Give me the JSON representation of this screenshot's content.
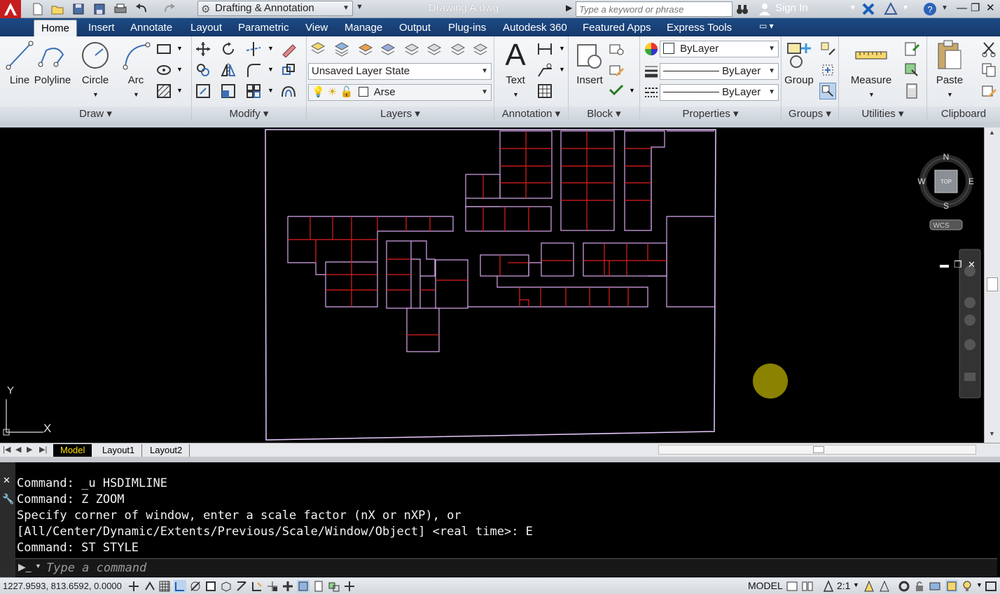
{
  "titlebar": {
    "workspace": "Drafting & Annotation",
    "document_title": "Drawing A.dwg",
    "search_placeholder": "Type a keyword or phrase",
    "sign_in": "Sign In"
  },
  "ribbon_tabs": [
    "Home",
    "Insert",
    "Annotate",
    "Layout",
    "Parametric",
    "View",
    "Manage",
    "Output",
    "Plug-ins",
    "Autodesk 360",
    "Featured Apps",
    "Express Tools"
  ],
  "active_tab": "Home",
  "draw_panel": {
    "title": "Draw",
    "tools": [
      "Line",
      "Polyline",
      "Circle",
      "Arc"
    ]
  },
  "modify_panel": {
    "title": "Modify"
  },
  "layers_panel": {
    "title": "Layers",
    "layer_state": "Unsaved Layer State",
    "current_layer": "Arse"
  },
  "annotation_panel": {
    "title": "Annotation",
    "text_label": "Text"
  },
  "block_panel": {
    "title": "Block",
    "insert_label": "Insert"
  },
  "properties_panel": {
    "title": "Properties",
    "color": "ByLayer",
    "linetype": "ByLayer",
    "lineweight": "ByLayer"
  },
  "groups_panel": {
    "title": "Groups",
    "group_label": "Group"
  },
  "utilities_panel": {
    "title": "Utilities",
    "measure_label": "Measure"
  },
  "clipboard_panel": {
    "title": "Clipboard",
    "paste_label": "Paste"
  },
  "viewcube": {
    "north": "N",
    "south": "S",
    "east": "E",
    "west": "W",
    "face": "TOP",
    "wcs": "WCS"
  },
  "ucs": {
    "x": "X",
    "y": "Y"
  },
  "layout_tabs": [
    "Model",
    "Layout1",
    "Layout2"
  ],
  "command_history": [
    "Command: _u HSDIMLINE",
    "Command: Z ZOOM",
    "Specify corner of window, enter a scale factor (nX or nXP), or",
    "[All/Center/Dynamic/Extents/Previous/Scale/Window/Object] <real time>: E",
    "Command: ST STYLE"
  ],
  "command_placeholder": "Type a command",
  "status": {
    "coordinates": "1227.9593, 813.6592, 0.0000",
    "model_label": "MODEL",
    "annotation_scale": "2:1"
  },
  "colors": {
    "tab_bar": "#1c4a86",
    "outline": "#e8c8ff",
    "partition": "#e0201c",
    "cursor_marker": "#8a8200"
  }
}
